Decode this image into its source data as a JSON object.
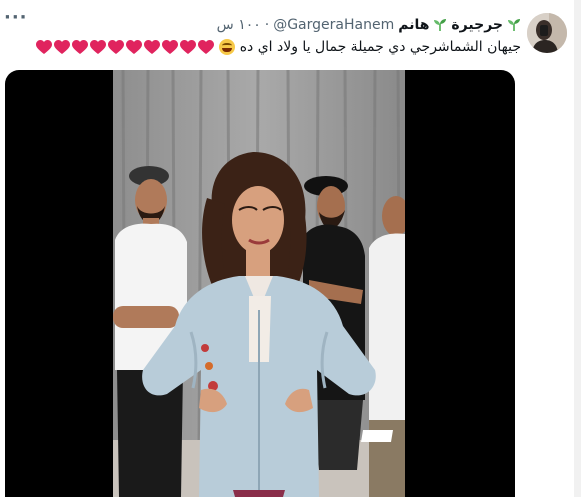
{
  "tweet": {
    "display_name": "جرجيرة",
    "display_name_suffix": "هانم",
    "handle": "@GargeraHanem",
    "separator": "·",
    "timestamp": "١٠٠ س",
    "more_label": "···",
    "text": "جيهان الشماشرجي دي جميلة جمال يا ولاد اي ده",
    "emoji_laugh": "face-with-tears-of-joy-icon",
    "hearts_count": 10
  },
  "colors": {
    "primary_text": "#0f1419",
    "secondary_text": "#536471",
    "heart": "#e0245e",
    "sprout": "#4caf50"
  }
}
